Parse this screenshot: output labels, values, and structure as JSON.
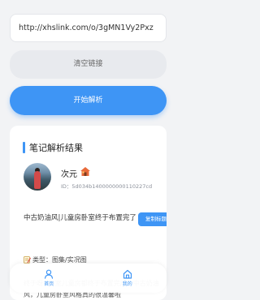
{
  "input": {
    "url_value": "http://xhslink.com/o/3gMN1Vy2Pxz"
  },
  "buttons": {
    "clear_label": "清空链接",
    "start_label": "开始解析"
  },
  "result": {
    "section_title": "笔记解析结果",
    "author": {
      "name": "次元",
      "id": "ID：5d034b1400000000110227cd"
    },
    "note_title": "中古奶油风|儿童房卧室终于布置完了",
    "copy_title_label": "复制标题",
    "type_line": "类型：图集/实况图",
    "description": "终于呀~卧室儿童房都终于布置完成！中古奶油风，儿童房卧室风格真的很温馨啦"
  },
  "tabbar": {
    "home_label": "首页",
    "mine_label": "我的"
  },
  "colors": {
    "accent": "#3e95f5",
    "background": "#f2f3f5"
  },
  "icons": {
    "avatar": "avatar-photo",
    "author_badge": "house-icon",
    "type_prefix": "memo-icon",
    "home_tab": "person-icon",
    "mine_tab": "home-icon"
  }
}
